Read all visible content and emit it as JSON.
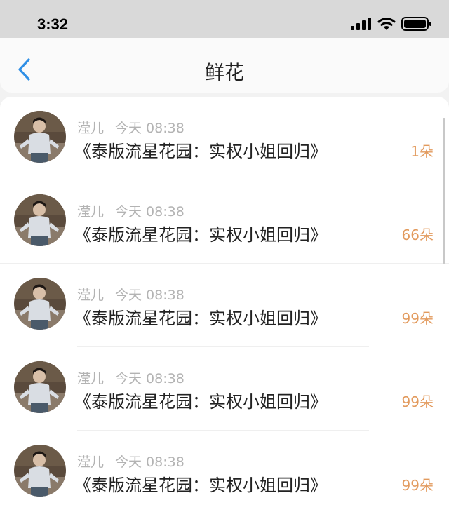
{
  "status_bar": {
    "time": "3:32"
  },
  "header": {
    "title": "鲜花"
  },
  "items": [
    {
      "user": "滢儿",
      "time": "今天 08:38",
      "book": "《泰版流星花园：实权小姐回归》",
      "count": "1朵"
    },
    {
      "user": "滢儿",
      "time": "今天 08:38",
      "book": "《泰版流星花园：实权小姐回归》",
      "count": "66朵"
    },
    {
      "user": "滢儿",
      "time": "今天 08:38",
      "book": "《泰版流星花园：实权小姐回归》",
      "count": "99朵"
    },
    {
      "user": "滢儿",
      "time": "今天 08:38",
      "book": "《泰版流星花园：实权小姐回归》",
      "count": "99朵"
    },
    {
      "user": "滢儿",
      "time": "今天 08:38",
      "book": "《泰版流星花园：实权小姐回归》",
      "count": "99朵"
    }
  ],
  "colors": {
    "accent_blue": "#2f8fe6",
    "count_orange": "#e29a5d",
    "meta_gray": "#b3b3b3"
  },
  "icons": [
    "chevron-left-icon",
    "signal-icon",
    "wifi-icon",
    "battery-icon"
  ]
}
